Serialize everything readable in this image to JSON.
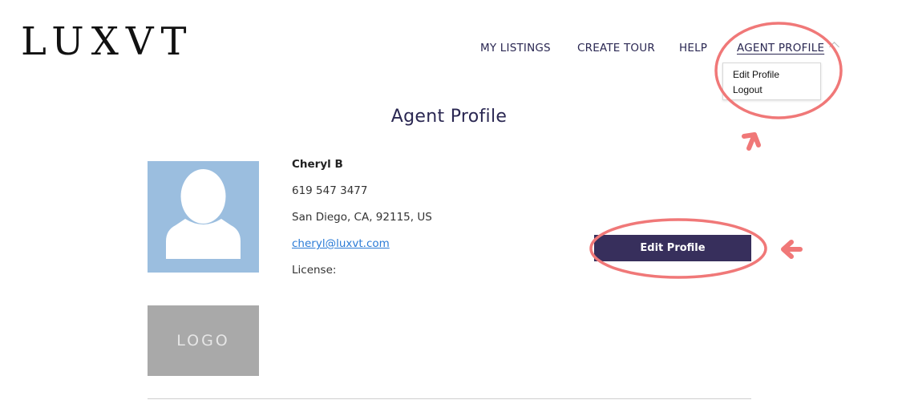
{
  "brand": {
    "logo_text": "LUXVT"
  },
  "nav": {
    "items": [
      {
        "label": "MY LISTINGS"
      },
      {
        "label": "CREATE TOUR"
      },
      {
        "label": "HELP"
      },
      {
        "label": "AGENT PROFILE"
      }
    ],
    "active_item": "AGENT PROFILE"
  },
  "dropdown": {
    "items": [
      {
        "label": "Edit Profile"
      },
      {
        "label": "Logout"
      }
    ]
  },
  "page": {
    "title": "Agent Profile"
  },
  "profile": {
    "name": "Cheryl B",
    "phone": "619 547 3477",
    "location": "San Diego, CA, 92115, US",
    "email": "cheryl@luxvt.com",
    "license_label": "License:",
    "logo_placeholder": "LOGO",
    "edit_button_label": "Edit Profile"
  },
  "colors": {
    "nav_text": "#2a2752",
    "button_bg": "#372f5c",
    "avatar_bg": "#9bbedf",
    "logo_bg": "#a9a9a9",
    "annotation": "#f07878",
    "link": "#2b7bd6"
  }
}
